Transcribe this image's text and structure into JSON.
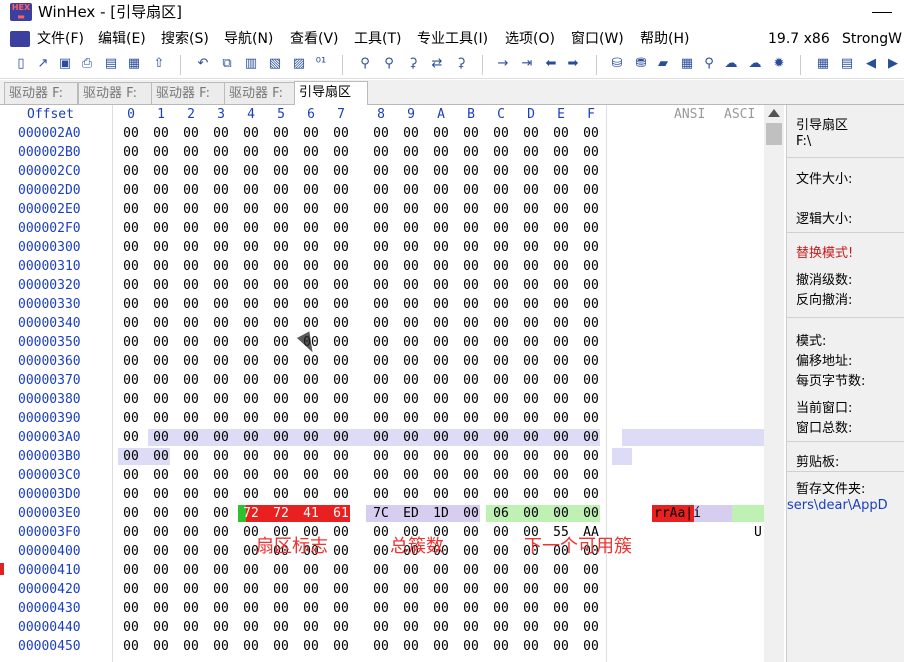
{
  "window": {
    "title": "WinHex - [引导扇区]"
  },
  "menu": {
    "items": [
      "文件(F)",
      "编辑(E)",
      "搜索(S)",
      "导航(N)",
      "查看(V)",
      "工具(T)",
      "专业工具(I)",
      "选项(O)",
      "窗口(W)",
      "帮助(H)"
    ],
    "version": "19.7 x86",
    "license": "StrongW"
  },
  "tabs": [
    "驱动器 F:",
    "驱动器 F:",
    "驱动器 F:",
    "驱动器 F:",
    "引导扇区"
  ],
  "header": {
    "offset_label": "Offset",
    "columns": [
      "0",
      "1",
      "2",
      "3",
      "4",
      "5",
      "6",
      "7",
      "8",
      "9",
      "A",
      "B",
      "C",
      "D",
      "E",
      "F"
    ],
    "ansi_label": "ANSI",
    "ascii_label": "ASCI"
  },
  "rows": [
    {
      "offset": "000002A0",
      "bytes": [
        "00",
        "00",
        "00",
        "00",
        "00",
        "00",
        "00",
        "00",
        "00",
        "00",
        "00",
        "00",
        "00",
        "00",
        "00",
        "00"
      ],
      "ascii": ""
    },
    {
      "offset": "000002B0",
      "bytes": [
        "00",
        "00",
        "00",
        "00",
        "00",
        "00",
        "00",
        "00",
        "00",
        "00",
        "00",
        "00",
        "00",
        "00",
        "00",
        "00"
      ],
      "ascii": ""
    },
    {
      "offset": "000002C0",
      "bytes": [
        "00",
        "00",
        "00",
        "00",
        "00",
        "00",
        "00",
        "00",
        "00",
        "00",
        "00",
        "00",
        "00",
        "00",
        "00",
        "00"
      ],
      "ascii": ""
    },
    {
      "offset": "000002D0",
      "bytes": [
        "00",
        "00",
        "00",
        "00",
        "00",
        "00",
        "00",
        "00",
        "00",
        "00",
        "00",
        "00",
        "00",
        "00",
        "00",
        "00"
      ],
      "ascii": ""
    },
    {
      "offset": "000002E0",
      "bytes": [
        "00",
        "00",
        "00",
        "00",
        "00",
        "00",
        "00",
        "00",
        "00",
        "00",
        "00",
        "00",
        "00",
        "00",
        "00",
        "00"
      ],
      "ascii": ""
    },
    {
      "offset": "000002F0",
      "bytes": [
        "00",
        "00",
        "00",
        "00",
        "00",
        "00",
        "00",
        "00",
        "00",
        "00",
        "00",
        "00",
        "00",
        "00",
        "00",
        "00"
      ],
      "ascii": ""
    },
    {
      "offset": "00000300",
      "bytes": [
        "00",
        "00",
        "00",
        "00",
        "00",
        "00",
        "00",
        "00",
        "00",
        "00",
        "00",
        "00",
        "00",
        "00",
        "00",
        "00"
      ],
      "ascii": ""
    },
    {
      "offset": "00000310",
      "bytes": [
        "00",
        "00",
        "00",
        "00",
        "00",
        "00",
        "00",
        "00",
        "00",
        "00",
        "00",
        "00",
        "00",
        "00",
        "00",
        "00"
      ],
      "ascii": ""
    },
    {
      "offset": "00000320",
      "bytes": [
        "00",
        "00",
        "00",
        "00",
        "00",
        "00",
        "00",
        "00",
        "00",
        "00",
        "00",
        "00",
        "00",
        "00",
        "00",
        "00"
      ],
      "ascii": ""
    },
    {
      "offset": "00000330",
      "bytes": [
        "00",
        "00",
        "00",
        "00",
        "00",
        "00",
        "00",
        "00",
        "00",
        "00",
        "00",
        "00",
        "00",
        "00",
        "00",
        "00"
      ],
      "ascii": ""
    },
    {
      "offset": "00000340",
      "bytes": [
        "00",
        "00",
        "00",
        "00",
        "00",
        "00",
        "00",
        "00",
        "00",
        "00",
        "00",
        "00",
        "00",
        "00",
        "00",
        "00"
      ],
      "ascii": ""
    },
    {
      "offset": "00000350",
      "bytes": [
        "00",
        "00",
        "00",
        "00",
        "00",
        "00",
        "00",
        "00",
        "00",
        "00",
        "00",
        "00",
        "00",
        "00",
        "00",
        "00"
      ],
      "ascii": ""
    },
    {
      "offset": "00000360",
      "bytes": [
        "00",
        "00",
        "00",
        "00",
        "00",
        "00",
        "00",
        "00",
        "00",
        "00",
        "00",
        "00",
        "00",
        "00",
        "00",
        "00"
      ],
      "ascii": ""
    },
    {
      "offset": "00000370",
      "bytes": [
        "00",
        "00",
        "00",
        "00",
        "00",
        "00",
        "00",
        "00",
        "00",
        "00",
        "00",
        "00",
        "00",
        "00",
        "00",
        "00"
      ],
      "ascii": ""
    },
    {
      "offset": "00000380",
      "bytes": [
        "00",
        "00",
        "00",
        "00",
        "00",
        "00",
        "00",
        "00",
        "00",
        "00",
        "00",
        "00",
        "00",
        "00",
        "00",
        "00"
      ],
      "ascii": ""
    },
    {
      "offset": "00000390",
      "bytes": [
        "00",
        "00",
        "00",
        "00",
        "00",
        "00",
        "00",
        "00",
        "00",
        "00",
        "00",
        "00",
        "00",
        "00",
        "00",
        "00"
      ],
      "ascii": ""
    },
    {
      "offset": "000003A0",
      "bytes": [
        "00",
        "00",
        "00",
        "00",
        "00",
        "00",
        "00",
        "00",
        "00",
        "00",
        "00",
        "00",
        "00",
        "00",
        "00",
        "00"
      ],
      "ascii": ""
    },
    {
      "offset": "000003B0",
      "bytes": [
        "00",
        "00",
        "00",
        "00",
        "00",
        "00",
        "00",
        "00",
        "00",
        "00",
        "00",
        "00",
        "00",
        "00",
        "00",
        "00"
      ],
      "ascii": ""
    },
    {
      "offset": "000003C0",
      "bytes": [
        "00",
        "00",
        "00",
        "00",
        "00",
        "00",
        "00",
        "00",
        "00",
        "00",
        "00",
        "00",
        "00",
        "00",
        "00",
        "00"
      ],
      "ascii": ""
    },
    {
      "offset": "000003D0",
      "bytes": [
        "00",
        "00",
        "00",
        "00",
        "00",
        "00",
        "00",
        "00",
        "00",
        "00",
        "00",
        "00",
        "00",
        "00",
        "00",
        "00"
      ],
      "ascii": ""
    },
    {
      "offset": "000003E0",
      "bytes": [
        "00",
        "00",
        "00",
        "00",
        "72",
        "72",
        "41",
        "61",
        "7C",
        "ED",
        "1D",
        "00",
        "06",
        "00",
        "00",
        "00"
      ],
      "ascii": "rrAa|í"
    },
    {
      "offset": "000003F0",
      "bytes": [
        "00",
        "00",
        "00",
        "00",
        "00",
        "00",
        "00",
        "00",
        "00",
        "00",
        "00",
        "00",
        "00",
        "00",
        "55",
        "AA"
      ],
      "ascii": "U"
    },
    {
      "offset": "00000400",
      "bytes": [
        "00",
        "00",
        "00",
        "00",
        "00",
        "00",
        "00",
        "00",
        "00",
        "00",
        "00",
        "00",
        "00",
        "00",
        "00",
        "00"
      ],
      "ascii": ""
    },
    {
      "offset": "00000410",
      "bytes": [
        "00",
        "00",
        "00",
        "00",
        "00",
        "00",
        "00",
        "00",
        "00",
        "00",
        "00",
        "00",
        "00",
        "00",
        "00",
        "00"
      ],
      "ascii": ""
    },
    {
      "offset": "00000420",
      "bytes": [
        "00",
        "00",
        "00",
        "00",
        "00",
        "00",
        "00",
        "00",
        "00",
        "00",
        "00",
        "00",
        "00",
        "00",
        "00",
        "00"
      ],
      "ascii": ""
    },
    {
      "offset": "00000430",
      "bytes": [
        "00",
        "00",
        "00",
        "00",
        "00",
        "00",
        "00",
        "00",
        "00",
        "00",
        "00",
        "00",
        "00",
        "00",
        "00",
        "00"
      ],
      "ascii": ""
    },
    {
      "offset": "00000440",
      "bytes": [
        "00",
        "00",
        "00",
        "00",
        "00",
        "00",
        "00",
        "00",
        "00",
        "00",
        "00",
        "00",
        "00",
        "00",
        "00",
        "00"
      ],
      "ascii": ""
    },
    {
      "offset": "00000450",
      "bytes": [
        "00",
        "00",
        "00",
        "00",
        "00",
        "00",
        "00",
        "00",
        "00",
        "00",
        "00",
        "00",
        "00",
        "00",
        "00",
        "00"
      ],
      "ascii": ""
    }
  ],
  "annotations": {
    "sector_flag": "扇区标志",
    "total_clusters": "总簇数",
    "next_free_cluster": "下一个可用簇"
  },
  "side_panel": {
    "title": "引导扇区",
    "drive": "F:\\",
    "file_size_label": "文件大小:",
    "logical_size_label": "逻辑大小:",
    "replace_mode": "替换模式!",
    "undo_levels_label": "撤消级数:",
    "redo_label": "反向撤消:",
    "mode_label": "模式:",
    "offset_addr_label": "偏移地址:",
    "bytes_per_page_label": "每页字节数:",
    "current_window_label": "当前窗口:",
    "total_windows_label": "窗口总数:",
    "clipboard_label": "剪贴板:",
    "temp_folder_label": "暂存文件夹:",
    "temp_folder_path": "sers\\dear\\AppD"
  },
  "colors": {
    "offset_blue": "#1a3fbf",
    "sector_flag_bg": "#e82020",
    "total_clusters_bg": "#d7cdf1",
    "next_free_bg": "#bff0b4",
    "selection_bg": "#dcdcf7",
    "annotation_red": "#e33333",
    "replace_mode_red": "#c81a1a"
  }
}
